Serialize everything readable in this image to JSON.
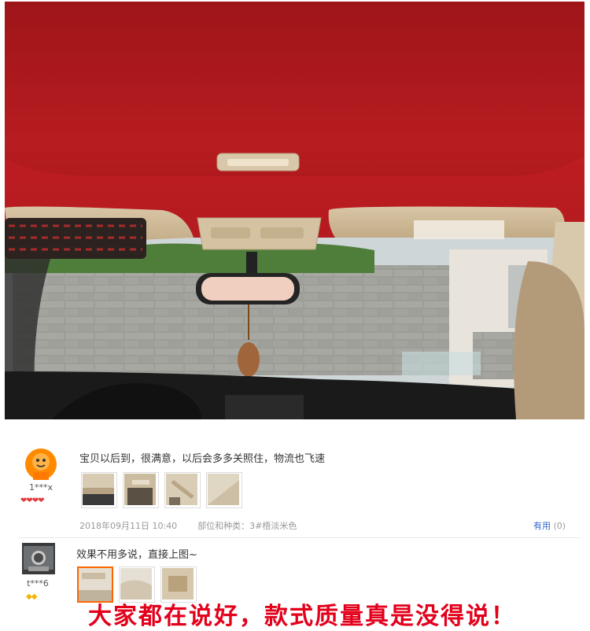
{
  "reviews": [
    {
      "username": "1***x",
      "text": "宝贝以后到，很满意，以后会多多关照住，物流也飞速",
      "date": "2018年09月11日 10:40",
      "category": "部位和种类：3#梧淡米色",
      "useful_label": "有用",
      "useful_count": "(0)",
      "badge_icon": "red-heart-icon"
    },
    {
      "username": "t***6",
      "text": "效果不用多说，直接上图~",
      "badge_icon": "yellow-diamond-icon"
    }
  ],
  "overlay_text": "大家都在说好，款式质量真是没得说！",
  "colors": {
    "headliner_red": "#b0191e",
    "link_blue": "#3366cc",
    "overlay_red": "#e3001b",
    "active_thumb": "#ff6600"
  }
}
